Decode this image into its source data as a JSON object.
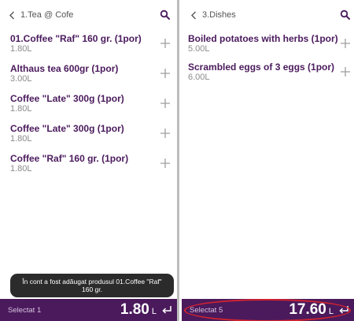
{
  "colors": {
    "footer_bg": "#4a1a5c",
    "item_name": "#4a1a5c",
    "price": "#8a8a8a",
    "highlight_ring": "#d3232f",
    "toast_bg": "#2b2b2b"
  },
  "left_panel": {
    "title": "1.Tea @ Cofe",
    "items": [
      {
        "name": "01.Coffee \"Raf\" 160 gr. (1por)",
        "price": "1.80L"
      },
      {
        "name": "Althaus tea 600gr (1por)",
        "price": "3.00L"
      },
      {
        "name": "Coffee \"Late\" 300g (1por)",
        "price": "1.80L"
      },
      {
        "name": "Coffee \"Late\" 300g (1por)",
        "price": "1.80L"
      },
      {
        "name": "Coffee \"Raf\" 160 gr. (1por)",
        "price": "1.80L"
      }
    ],
    "toast": "În cont a fost adăugat produsul 01.Coffee \"Raf\" 160 gr.",
    "footer": {
      "selected": "Selectat 1",
      "total": "1.80",
      "unit": "L"
    }
  },
  "right_panel": {
    "title": "3.Dishes",
    "items": [
      {
        "name": "Boiled potatoes with herbs (1por)",
        "price": "5.00L"
      },
      {
        "name": "Scrambled eggs of 3 eggs (1por)",
        "price": "6.00L"
      }
    ],
    "footer": {
      "selected": "Selectat 5",
      "total": "17.60",
      "unit": "L"
    }
  },
  "icons": {
    "back": "chevron-left-icon",
    "search": "search-icon",
    "add": "plus-icon",
    "confirm": "enter-arrow-icon"
  }
}
